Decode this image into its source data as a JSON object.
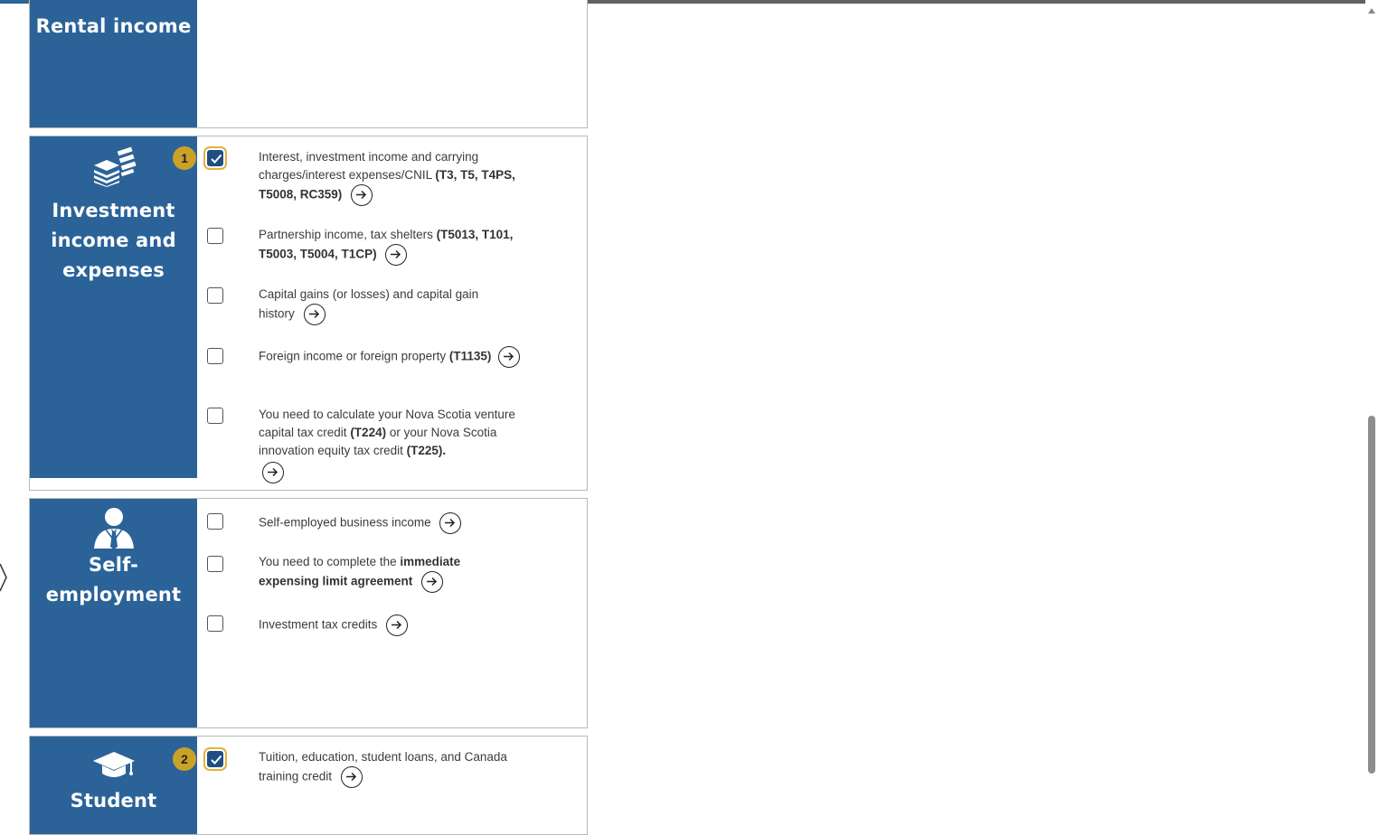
{
  "sections": {
    "rental": {
      "title": "Rental income"
    },
    "investment": {
      "title_lines": [
        "Investment",
        "income and",
        "expenses"
      ],
      "items": [
        {
          "text": "Interest, investment income and carrying charges/interest expenses/CNIL",
          "forms": "(T3, T5, T4PS, T5008, RC359)",
          "checked": true,
          "badge": "1"
        },
        {
          "text": "Partnership income, tax shelters",
          "forms": "(T5013, T101, T5003, T5004, T1CP)",
          "checked": false
        },
        {
          "text": "Capital gains (or losses) and capital gain history",
          "checked": false
        },
        {
          "text": "Foreign income or foreign property",
          "forms": "(T1135)",
          "checked": false
        },
        {
          "text_a": "You need to calculate your Nova Scotia venture capital tax credit",
          "forms_a": "(T224)",
          "text_b": "or your Nova Scotia innovation equity tax credit",
          "forms_b": "(T225).",
          "checked": false
        }
      ]
    },
    "self_employment": {
      "title_lines": [
        "Self-",
        "employment"
      ],
      "items": [
        {
          "text": "Self-employed business income",
          "checked": false
        },
        {
          "text": "You need to complete the",
          "bold": "immediate expensing limit agreement",
          "checked": false
        },
        {
          "text": "Investment tax credits",
          "checked": false
        }
      ]
    },
    "student": {
      "title": "Student",
      "items": [
        {
          "text": "Tuition, education, student loans, and Canada training credit",
          "checked": true,
          "badge": "2"
        }
      ]
    }
  },
  "icons": {
    "investment": "money-stack-icon",
    "self_employment": "businessperson-icon",
    "student": "graduation-cap-icon",
    "arrow": "arrow-right-circle-icon"
  },
  "colors": {
    "sidebar": "#2b6399",
    "badge": "#c9a227",
    "checked": "#1f4e82"
  }
}
